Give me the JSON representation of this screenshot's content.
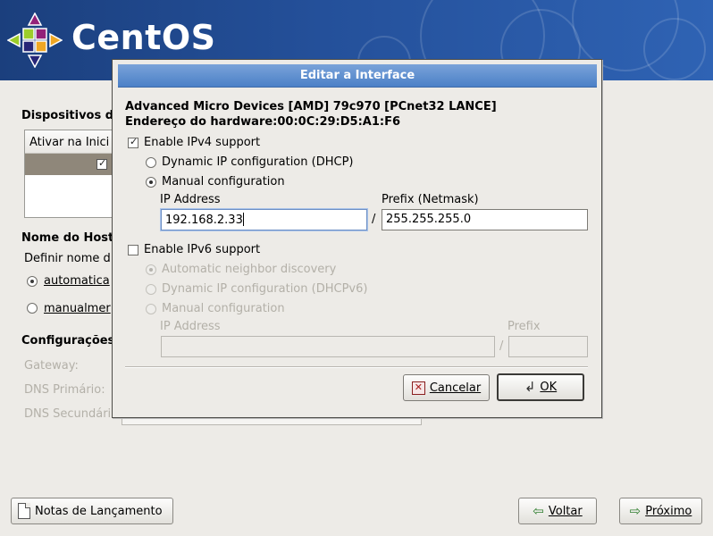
{
  "header": {
    "brand": "CentOS"
  },
  "background": {
    "devices_title": "Dispositivos d",
    "devices_list_header": "Ativar na Inici",
    "hostname_title": "Nome do Host",
    "hostname_define": "Definir nome d",
    "radio_auto": "automatica",
    "radio_manual": "manualmer",
    "settings_title": "Configurações",
    "gateway_label": "Gateway:",
    "dns_primary_label": "DNS Primário:",
    "dns_secondary_label": "DNS Secundári"
  },
  "footer": {
    "release_notes": "Notas de Lançamento",
    "back": "Voltar",
    "next": "Próximo"
  },
  "dialog": {
    "title": "Editar a Interface",
    "device_name": "Advanced Micro Devices [AMD] 79c970 [PCnet32 LANCE]",
    "hardware_address": "Endereço do hardware:00:0C:29:D5:A1:F6",
    "ipv4": {
      "enable_label": "Enable IPv4 support",
      "enabled": true,
      "dhcp_label": "Dynamic IP configuration (DHCP)",
      "manual_label": "Manual configuration",
      "selected": "manual",
      "ip_label": "IP Address",
      "ip_value": "192.168.2.33",
      "prefix_label": "Prefix (Netmask)",
      "prefix_value": "255.255.255.0",
      "slash": "/"
    },
    "ipv6": {
      "enable_label": "Enable IPv6 support",
      "enabled": false,
      "auto_label": "Automatic neighbor discovery",
      "dhcp_label": "Dynamic IP configuration (DHCPv6)",
      "manual_label": "Manual configuration",
      "selected": "auto",
      "ip_label": "IP Address",
      "ip_value": "",
      "prefix_label": "Prefix",
      "prefix_value": "",
      "slash": "/"
    },
    "cancel": "Cancelar",
    "ok": "OK"
  }
}
